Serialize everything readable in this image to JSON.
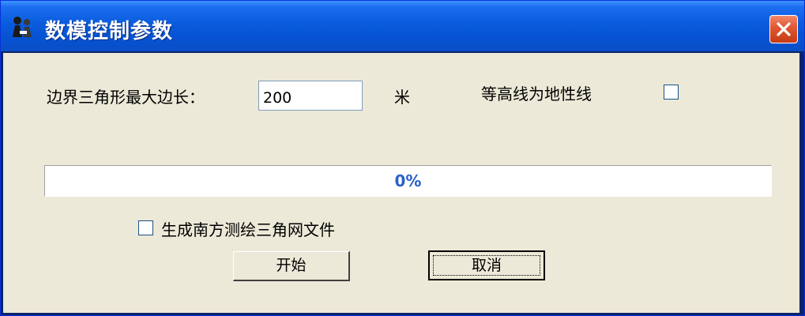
{
  "window": {
    "title": "数模控制参数",
    "title_bar_color": "#0a5cdd",
    "close_button_color": "#e05a36"
  },
  "form": {
    "max_edge_label": "边界三角形最大边长：",
    "max_edge_value": "200",
    "unit_label": "米",
    "contour_checkbox_label": "等高线为地性线",
    "contour_checked": false,
    "south_tin_checkbox_label": "生成南方测绘三角网文件",
    "south_tin_checked": false
  },
  "progress": {
    "value_fraction": 0,
    "label": "0%",
    "color": "#2b61c9"
  },
  "buttons": {
    "start_label": "开始",
    "cancel_label": "取消"
  },
  "icons": {
    "title_icon": "app-figures-icon",
    "close_icon": "close-icon"
  },
  "colors": {
    "dialog_background": "#ece9d8"
  }
}
